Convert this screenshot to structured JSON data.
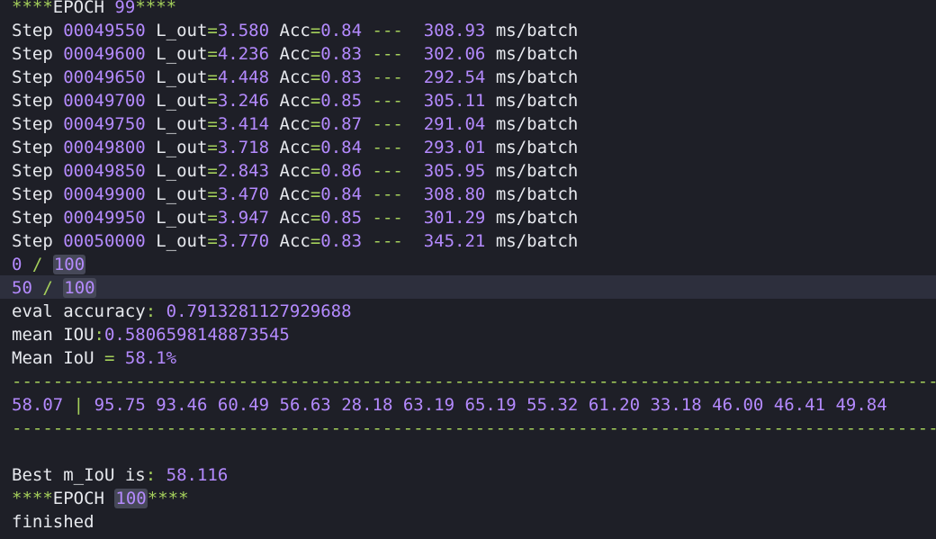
{
  "epoch_header": {
    "stars_left": "****",
    "label": "EPOCH",
    "number": "99",
    "stars_right": "****"
  },
  "labels": {
    "step": "Step",
    "loss": "L_out",
    "acc": "Acc",
    "eq": "=",
    "sep": "---",
    "unit": "ms/batch"
  },
  "steps": [
    {
      "step": "00049550",
      "loss": "3.580",
      "acc": "0.84",
      "ms": "308.93"
    },
    {
      "step": "00049600",
      "loss": "4.236",
      "acc": "0.83",
      "ms": "302.06"
    },
    {
      "step": "00049650",
      "loss": "4.448",
      "acc": "0.83",
      "ms": "292.54"
    },
    {
      "step": "00049700",
      "loss": "3.246",
      "acc": "0.85",
      "ms": "305.11"
    },
    {
      "step": "00049750",
      "loss": "3.414",
      "acc": "0.87",
      "ms": "291.04"
    },
    {
      "step": "00049800",
      "loss": "3.718",
      "acc": "0.84",
      "ms": "293.01"
    },
    {
      "step": "00049850",
      "loss": "2.843",
      "acc": "0.86",
      "ms": "305.95"
    },
    {
      "step": "00049900",
      "loss": "3.470",
      "acc": "0.84",
      "ms": "308.80"
    },
    {
      "step": "00049950",
      "loss": "3.947",
      "acc": "0.85",
      "ms": "301.29"
    },
    {
      "step": "00050000",
      "loss": "3.770",
      "acc": "0.83",
      "ms": "345.21"
    }
  ],
  "progress": [
    {
      "current": "0",
      "slash": "/",
      "total": "100"
    },
    {
      "current": "50",
      "slash": "/",
      "total": "100"
    }
  ],
  "eval": {
    "accuracy_label": "eval accuracy",
    "accuracy_colon": ":",
    "accuracy_value": "0.7913281127929688",
    "mean_iou_label": "mean IOU",
    "mean_iou_colon": ":",
    "mean_iou_value": "0.5806598148873545",
    "mean_iou_pct_label": "Mean IoU",
    "mean_iou_pct_eq": "=",
    "mean_iou_pct_value": "58.1%"
  },
  "separator": "-----------------------------------------------------------------------------------------------------------",
  "class_scores": {
    "mean": "58.07",
    "bar": "|",
    "values": [
      "95.75",
      "93.46",
      "60.49",
      "56.63",
      "28.18",
      "63.19",
      "65.19",
      "55.32",
      "61.20",
      "33.18",
      "46.00",
      "46.41",
      "49.84"
    ]
  },
  "best": {
    "label": "Best m_IoU is",
    "colon": ":",
    "value": "58.116"
  },
  "next_epoch": {
    "stars_left": "****",
    "label": "EPOCH",
    "number": "100",
    "stars_right": "****"
  },
  "finished": "finished",
  "colors": {
    "background": "#1e1f27",
    "text": "#e7e9ee",
    "green": "#a5d05b",
    "purple": "#b48afe",
    "highlight_row": "#2d2f3d",
    "highlight_box": "#464858"
  }
}
